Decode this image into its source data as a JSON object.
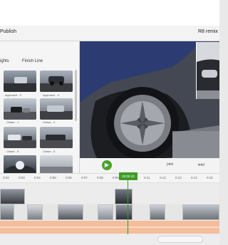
{
  "titlebar": {
    "publish": "Publish",
    "project": "R8 remix"
  },
  "library": {
    "tabs": [
      "ights",
      "Finish Line"
    ],
    "items": [
      "Approach - 3",
      "Approach - 4",
      "Chase - 1",
      "Chase - 2",
      "Chase - 5",
      "Chase - 6"
    ]
  },
  "controls": {
    "prev": "⏮",
    "play": "▶",
    "next": "⏭"
  },
  "ruler": {
    "ticks": [
      "0:02",
      "0:03",
      "0:04",
      "0:05",
      "0:06",
      "0:07",
      "0:08",
      "0:09",
      "0:11",
      "0:12",
      "0:13",
      "0:14",
      "0:15"
    ]
  },
  "timeline": {
    "playhead": "00:09.22"
  },
  "colors": {
    "accent": "#3f9b28",
    "audio": "#f4bd9b"
  }
}
